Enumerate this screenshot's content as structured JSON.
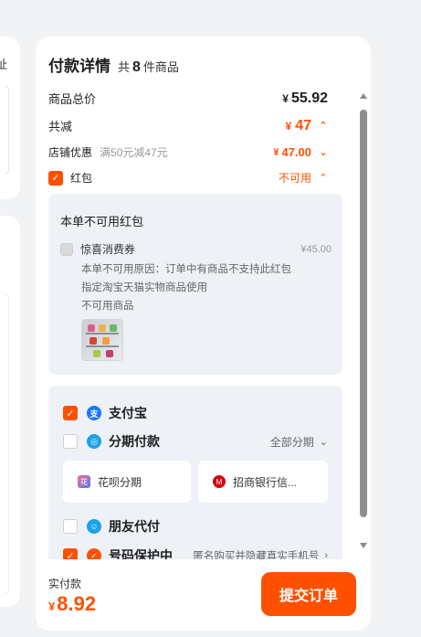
{
  "left": {
    "addr_char": "址"
  },
  "header": {
    "title": "付款详情",
    "count_pre": "共",
    "count_num": "8",
    "count_post": "件商品"
  },
  "summary": {
    "total_label": "商品总价",
    "total_currency": "¥",
    "total_value": "55.92",
    "discount_label": "共减",
    "discount_currency": "¥",
    "discount_value": "47",
    "store_label": "店铺优惠",
    "store_rule": "满50元减47元",
    "store_currency": "¥",
    "store_value": "47.00",
    "redpacket_label": "红包",
    "redpacket_status": "不可用"
  },
  "redpacket_panel": {
    "title": "本单不可用红包",
    "coupon_name": "惊喜消费券",
    "coupon_value": "¥45.00",
    "reason_1": "本单不可用原因：订单中有商品不支持此红包",
    "reason_2": "指定淘宝天猫实物商品使用",
    "reason_3": "不可用商品"
  },
  "payment": {
    "alipay": "支付宝",
    "installment": "分期付款",
    "installment_option": "全部分期",
    "huabei": "花呗分期",
    "cmb": "招商银行信...",
    "friend": "朋友代付",
    "privacy": "号码保护中",
    "privacy_desc": "匿名购买并隐藏真实手机号"
  },
  "footer": {
    "paid_label": "实付款",
    "currency": "¥",
    "paid_value": "8.92",
    "submit": "提交订单"
  },
  "colors": {
    "accent": "#ff5000",
    "alipay": "#1677ff",
    "installment": "#1aa3e8",
    "friend": "#1aa3e8",
    "privacy": "#ff5000"
  },
  "icons": {
    "chevron_up": "chevron-up-icon",
    "chevron_down": "chevron-down-icon",
    "chevron_right": "chevron-right-icon"
  }
}
